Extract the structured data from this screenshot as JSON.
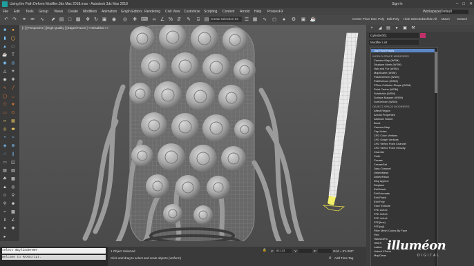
{
  "window": {
    "title": "Using the Path Deform Modifier.3ds Max 2018.max - Autodesk 3ds Max 2018",
    "sign_in": "Sign In",
    "workspaces_label": "Workspaces:",
    "workspace_value": "Default"
  },
  "menu": [
    "File",
    "Edit",
    "Tools",
    "Group",
    "Views",
    "Create",
    "Modifiers",
    "Animation",
    "Graph Editors",
    "Rendering",
    "Civil View",
    "Customize",
    "Scripting",
    "Content",
    "Arnold",
    "Help",
    "ProxiesFX"
  ],
  "toolbar": {
    "selection_set": "Create Selection Se",
    "right_items": [
      "Center Pivot",
      "Extr. Poly",
      "Edit Poly",
      "Hide Selected",
      "Unhide All",
      "Attach",
      "Detach"
    ]
  },
  "viewport": {
    "label": "[+] [Perspective ] [High Quality ] [Edged Faces ]  <<Disabled >>"
  },
  "command_panel": {
    "object_name": "Cylinder001",
    "modifier_list_label": "Modifier List",
    "dropdown": {
      "selected": "Use Pivot Points",
      "sections": [
        {
          "heading": "WORLD-SPACE MODIFIERS",
          "items": [
            "Camera Map (WSM)",
            "Displace Mesh (WSM)",
            "Hair and Fur (WSM)",
            "MapScaler (WSM)",
            "PatchDeform (WSM)",
            "PathDeform (WSM)",
            "PFlow Collision Shape (WSM)",
            "Point Cache (WSM)",
            "Subdivide (WSM)",
            "Surface Mapper (WSM)",
            "SurfDeform (WSM)"
          ]
        },
        {
          "heading": "OBJECT-SPACE MODIFIERS",
          "items": [
            "Affect Region",
            "Arnold Properties",
            "Attribute Holder",
            "Bend",
            "Camera Map",
            "Cap Holes",
            "CFD Color Vertices",
            "CFD Graph Vertices",
            "CFD Vertex Point Channel",
            "CFD Vertex Point Velocity",
            "Chamfer",
            "Cloth",
            "Crease",
            "CreaseSet",
            "Data Channel",
            "DeleteMesh",
            "DeletePatch",
            "Disp Approx",
            "Displace",
            "Edit Mesh",
            "Edit Normals",
            "Edit Patch",
            "Edit Poly",
            "Face Extrude",
            "FFD 2x2x2",
            "FFD 3x3x3",
            "FFD 4x4x4",
            "FFD(box)",
            "FFD(cyl)",
            "Filter Mesh Colors By Face",
            "Flex",
            "HairAndFur",
            "HSDS",
            "Lattice",
            "Linked XForm",
            "MapClean"
          ]
        }
      ]
    }
  },
  "status": {
    "maxscript_line1": "select $Cylinder007",
    "maxscript_line2": "Welcome to MAXScript.",
    "selected": "1 Object Selected",
    "prompt": "Click and drag to select and scale objects (uniform)",
    "x_label": "X:",
    "x_value": "82.123",
    "y_label": "Y:",
    "z_label": "Z:",
    "grid": "Grid = 0'1.000\"",
    "add_time_tag": "Add Time Tag"
  },
  "branding": {
    "logo": "illuméon",
    "logo_sub": "DIGITAL"
  }
}
